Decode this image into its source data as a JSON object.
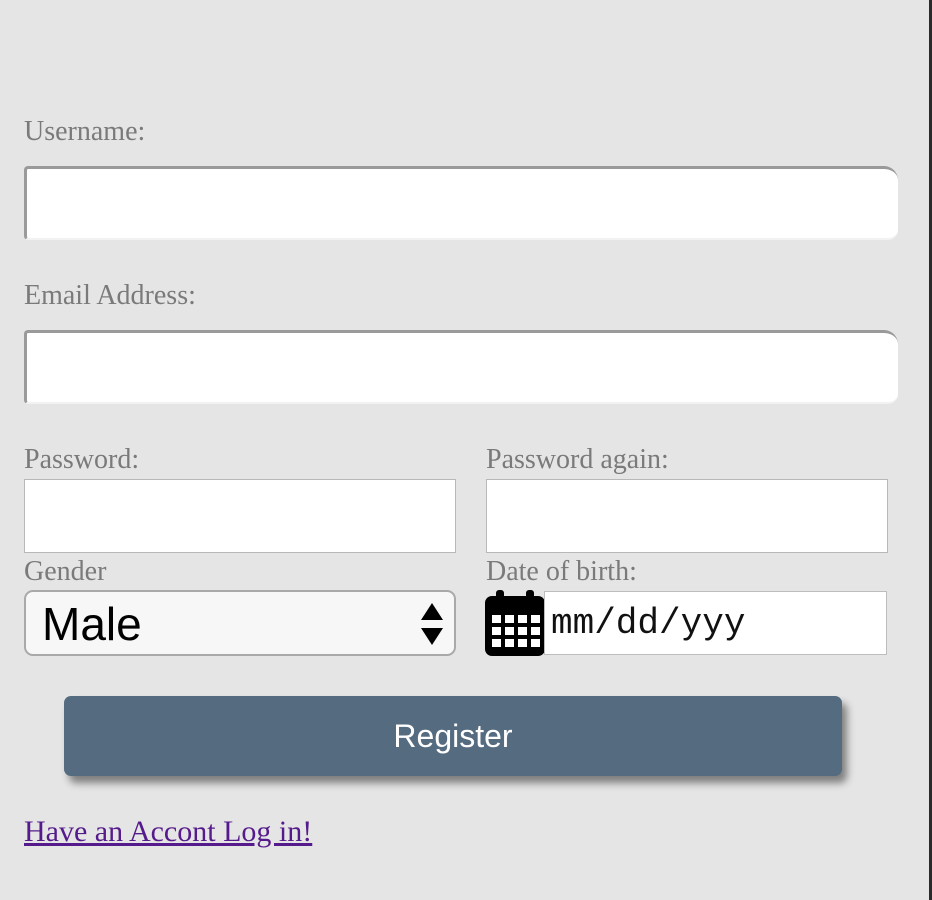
{
  "form": {
    "username": {
      "label": "Username:",
      "value": ""
    },
    "email": {
      "label": "Email Address:",
      "value": ""
    },
    "password": {
      "label": "Password:",
      "value": ""
    },
    "password_again": {
      "label": "Password again:",
      "value": ""
    },
    "gender": {
      "label": "Gender",
      "selected": "Male"
    },
    "dob": {
      "label": "Date of birth:",
      "placeholder": "mm/dd/yyy"
    },
    "register_label": "Register",
    "login_link": "Have an Accont Log in!"
  },
  "colors": {
    "background": "#e5e5e5",
    "label_text": "#7a7a7a",
    "button": "#546b80",
    "link": "#551a8b"
  },
  "icons": {
    "gender_select": "up-down-arrows-icon",
    "dob": "calendar-icon"
  }
}
